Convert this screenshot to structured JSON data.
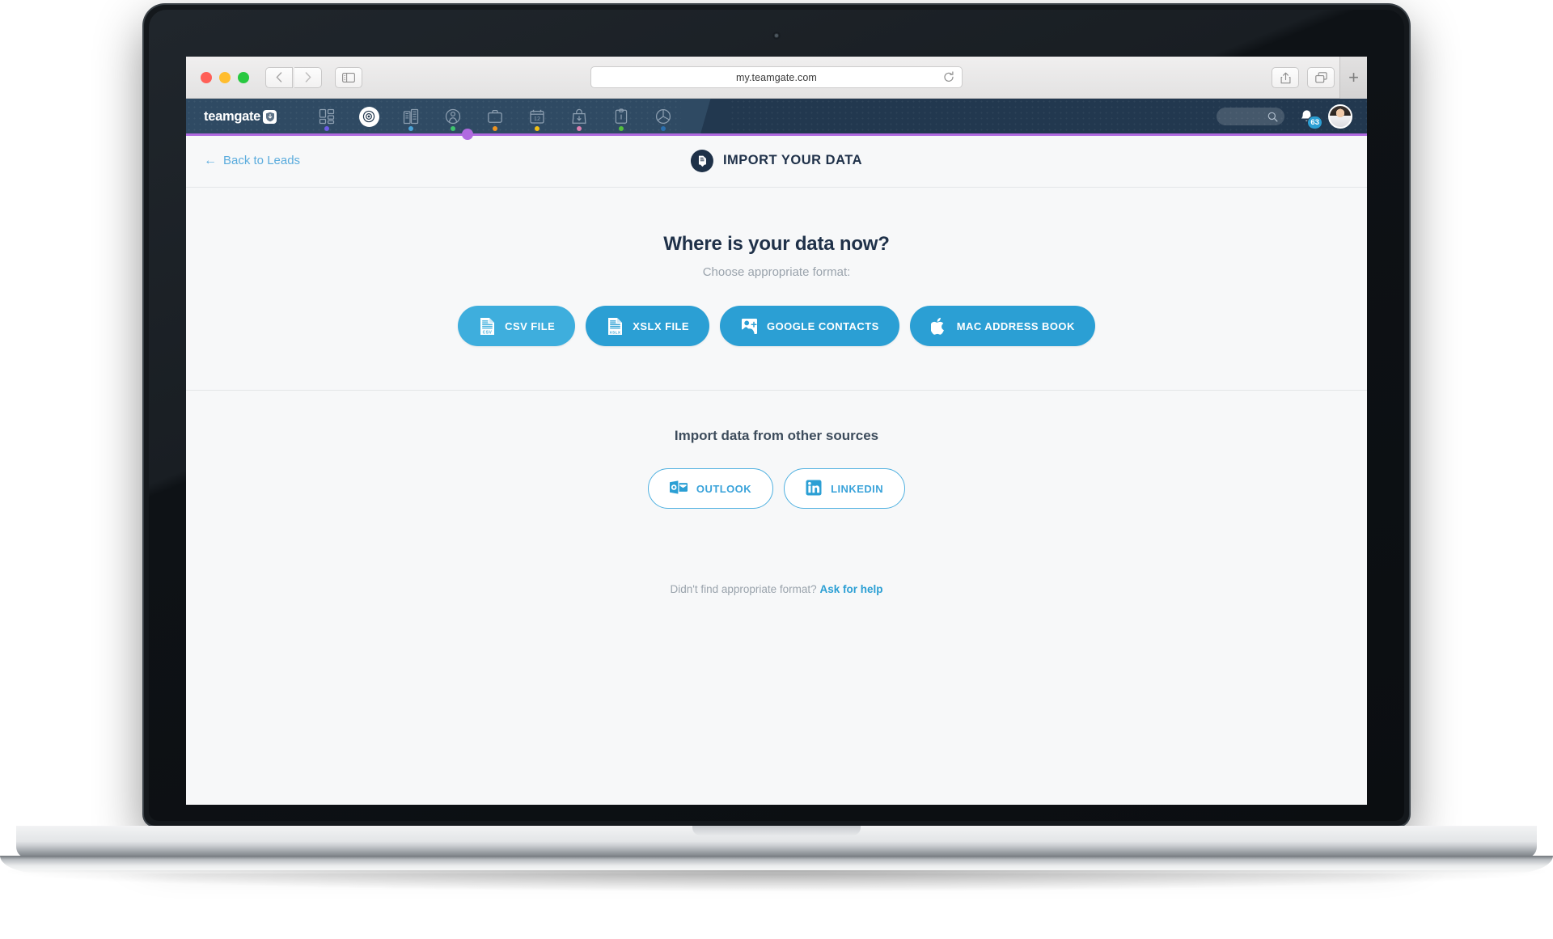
{
  "browser": {
    "url": "my.teamgate.com",
    "reload_icon": "reload-icon",
    "back_icon": "chevron-left-icon",
    "forward_icon": "chevron-right-icon",
    "sidebar_icon": "sidebar-icon",
    "share_icon": "share-icon",
    "tabs_icon": "tabs-icon",
    "new_tab_label": "+"
  },
  "app_nav": {
    "logo_text": "teamgate",
    "logo_mark_icon": "teamgate-shield-icon",
    "accent_color": "#b06ae0",
    "bar_color": "#22384f",
    "items": [
      {
        "name": "dashboard",
        "icon": "dashboard-grid-icon",
        "dot": "#6c5ce7",
        "active": false
      },
      {
        "name": "leads",
        "icon": "target-icon",
        "dot": "",
        "active": true
      },
      {
        "name": "companies",
        "icon": "buildings-icon",
        "dot": "#4aa3d8",
        "active": false
      },
      {
        "name": "contacts",
        "icon": "person-circle-icon",
        "dot": "#3ec46d",
        "active": false
      },
      {
        "name": "deals",
        "icon": "briefcase-icon",
        "dot": "#ef9421",
        "active": false
      },
      {
        "name": "calendar",
        "icon": "calendar-12-icon",
        "dot": "#f2c014",
        "active": false
      },
      {
        "name": "products",
        "icon": "bag-download-icon",
        "dot": "#dd7fb0",
        "active": false
      },
      {
        "name": "tasks",
        "icon": "clipboard-icon",
        "dot": "#53c03d",
        "active": false
      },
      {
        "name": "insights",
        "icon": "pie-chart-icon",
        "dot": "#2b6fae",
        "active": false
      }
    ],
    "search_icon": "search-icon",
    "search_placeholder": "",
    "notifications_icon": "bell-icon",
    "notifications_count": "63",
    "avatar_name": "user-avatar"
  },
  "page_header": {
    "back_label": "Back to Leads",
    "back_icon": "arrow-left-icon",
    "title": "IMPORT YOUR DATA",
    "title_icon": "import-document-icon"
  },
  "main": {
    "heading": "Where is your data now?",
    "subheading": "Choose appropriate format:",
    "format_buttons": [
      {
        "label": "CSV FILE",
        "icon": "csv-file-icon",
        "color": "#3eaedd"
      },
      {
        "label": "XSLX FILE",
        "icon": "xslx-file-icon",
        "color": "#2b9fd4"
      },
      {
        "label": "GOOGLE CONTACTS",
        "icon": "google-plus-icon",
        "color": "#2b9fd4"
      },
      {
        "label": "MAC ADDRESS BOOK",
        "icon": "apple-icon",
        "color": "#2b9fd4"
      }
    ],
    "other_sources_heading": "Import data from other sources",
    "source_buttons": [
      {
        "label": "OUTLOOK",
        "icon": "outlook-icon"
      },
      {
        "label": "LINKEDIN",
        "icon": "linkedin-icon"
      }
    ],
    "help_text": "Didn't find appropriate format?",
    "help_link": "Ask for help"
  }
}
